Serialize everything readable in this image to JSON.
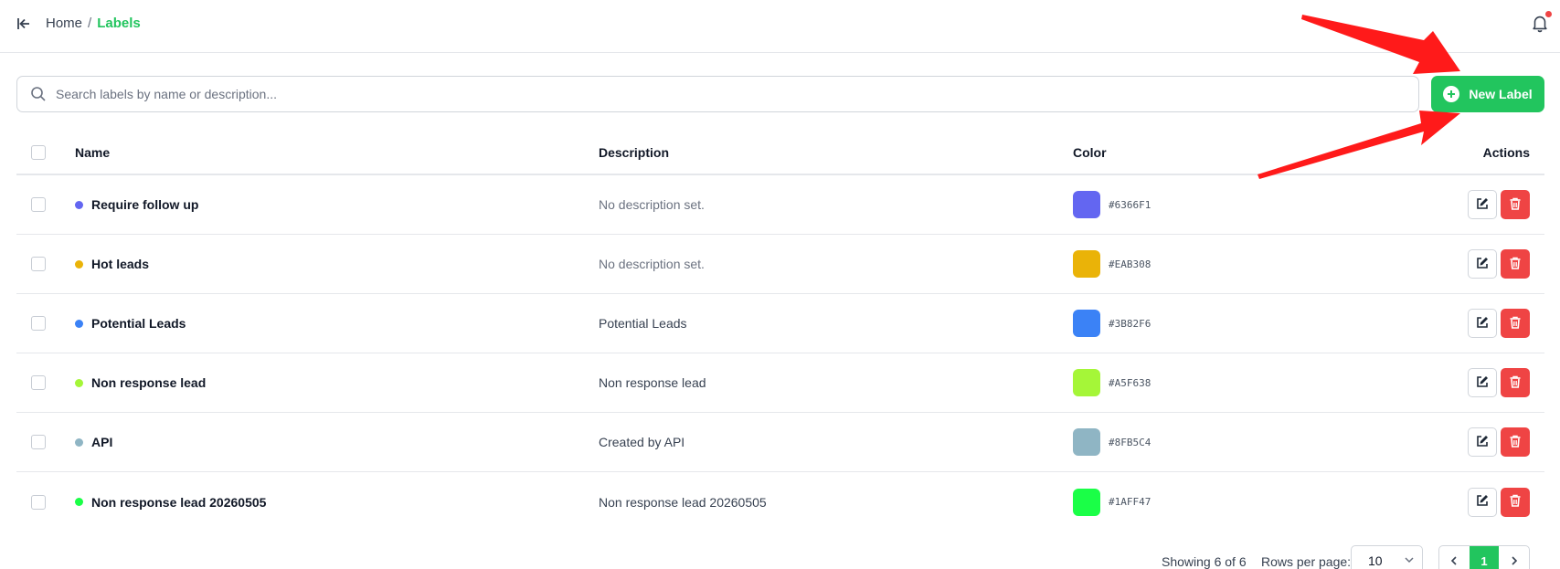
{
  "breadcrumb": {
    "home": "Home",
    "separator": "/",
    "current": "Labels"
  },
  "icons": {
    "collapse": "collapse-sidebar-icon",
    "bell": "bell-icon",
    "search": "search-icon",
    "plus": "plus-circle-icon",
    "edit": "edit-icon",
    "delete": "trash-icon"
  },
  "search": {
    "placeholder": "Search labels by name or description...",
    "value": ""
  },
  "toolbar": {
    "new_label": "New Label"
  },
  "colors": {
    "accent": "#22c55e",
    "danger": "#ef4444",
    "annotation_arrow": "#ff1a1a"
  },
  "table": {
    "headers": {
      "name": "Name",
      "description": "Description",
      "color": "Color",
      "actions": "Actions"
    },
    "rows": [
      {
        "name": "Require follow up",
        "description": "No description set.",
        "empty": true,
        "color": "#6366F1"
      },
      {
        "name": "Hot leads",
        "description": "No description set.",
        "empty": true,
        "color": "#EAB308"
      },
      {
        "name": "Potential Leads",
        "description": "Potential Leads",
        "empty": false,
        "color": "#3B82F6"
      },
      {
        "name": "Non response lead",
        "description": "Non response lead",
        "empty": false,
        "color": "#A5F638"
      },
      {
        "name": "API",
        "description": "Created by API",
        "empty": false,
        "color": "#8FB5C4"
      },
      {
        "name": "Non response lead 20260505",
        "description": "Non response lead 20260505",
        "empty": false,
        "color": "#1AFF47"
      }
    ]
  },
  "footer": {
    "showing": "Showing 6 of 6",
    "rows_per_page_label": "Rows per page:",
    "rows_per_page": "10",
    "current_page": "1"
  }
}
